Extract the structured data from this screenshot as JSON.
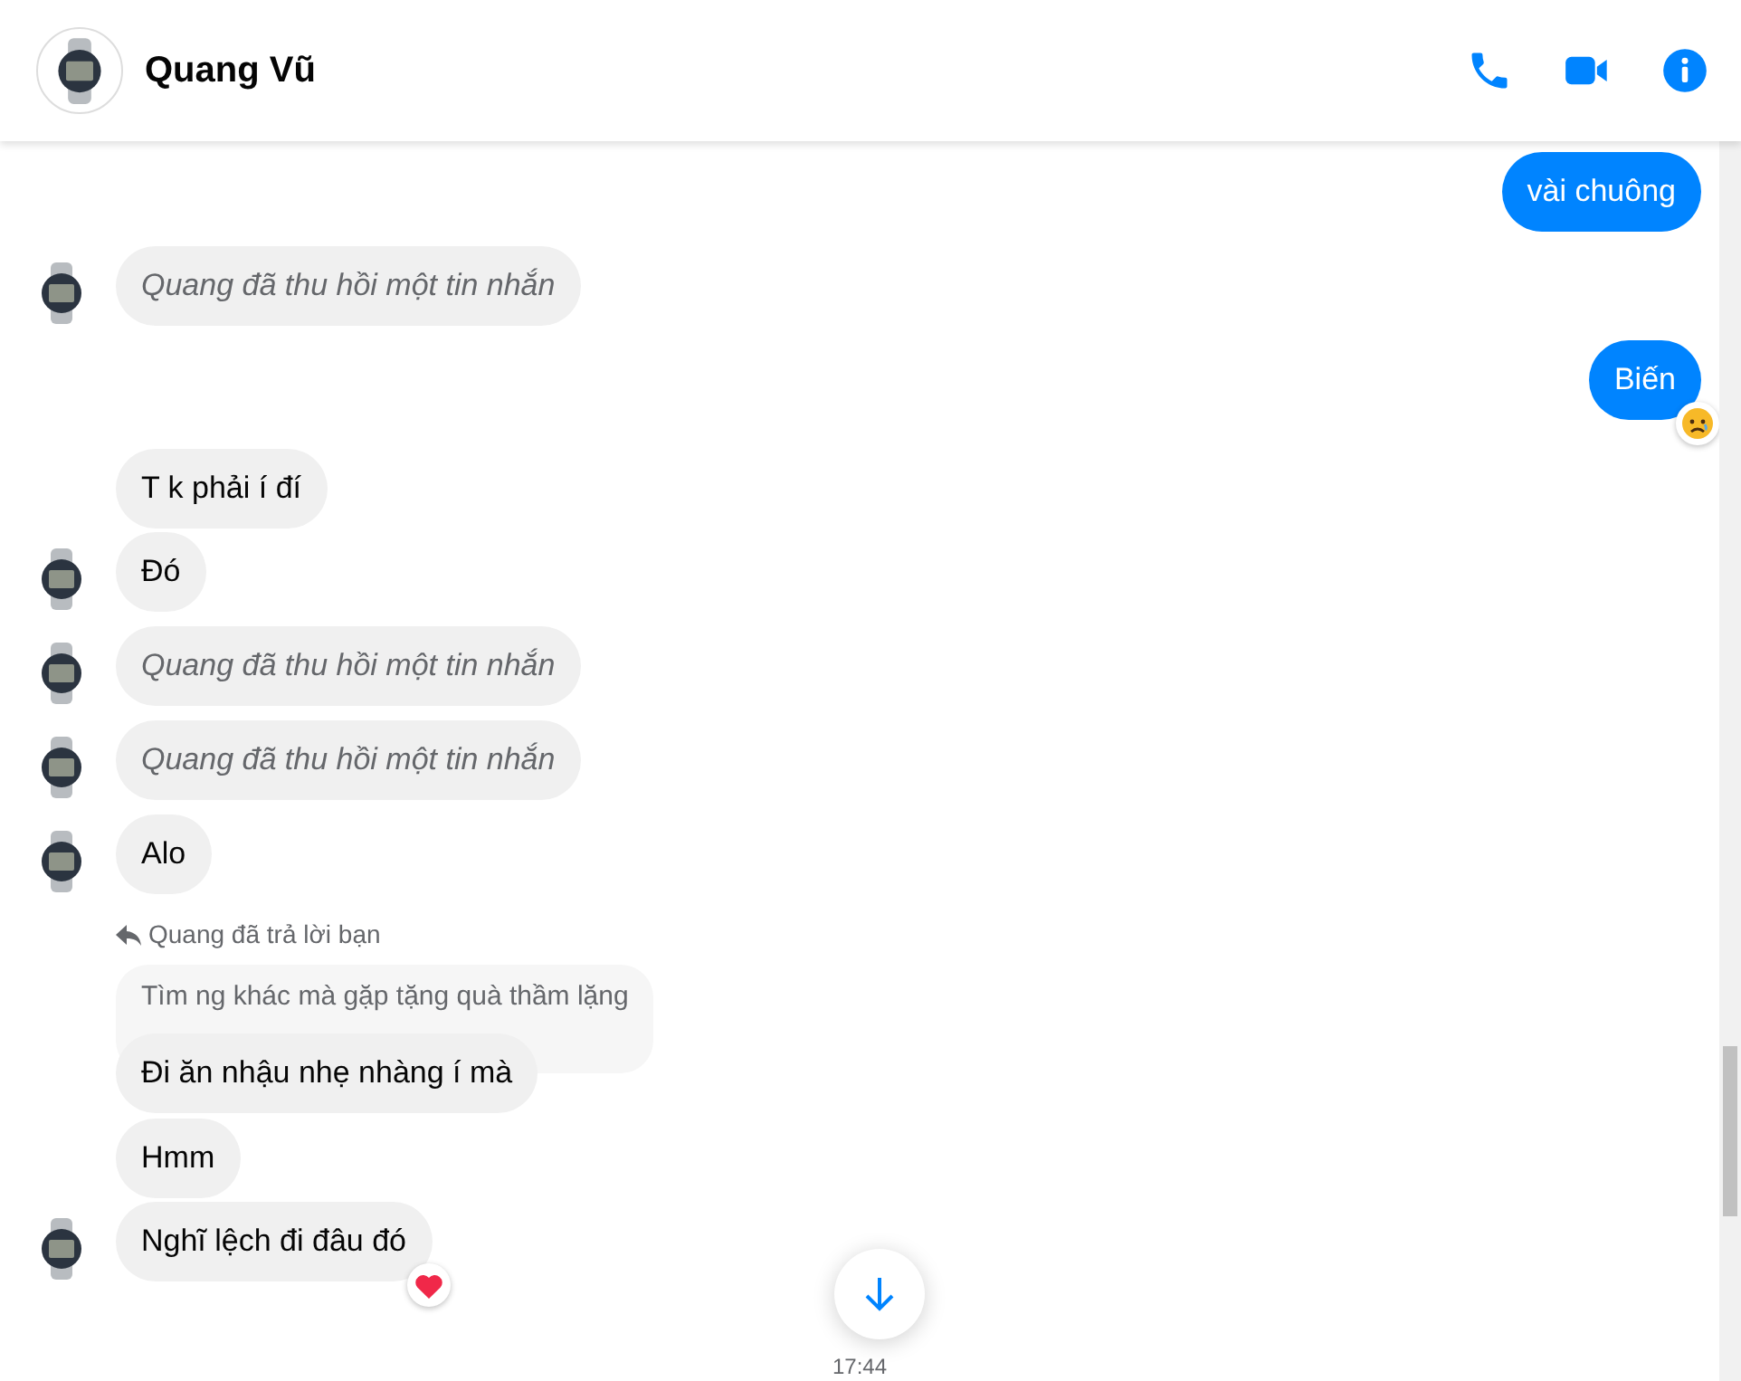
{
  "header": {
    "name": "Quang Vũ"
  },
  "messages": [
    {
      "outgoing": true,
      "kind": "text",
      "text": "vài chuông"
    },
    {
      "outgoing": false,
      "kind": "unsent",
      "text": "Quang đã thu hồi một tin nhắn",
      "avatar": true
    },
    {
      "outgoing": true,
      "kind": "text",
      "text": "Biến",
      "reaction": {
        "kind": "sad"
      }
    },
    {
      "outgoing": false,
      "kind": "text",
      "text": "T k phải í đí",
      "avatar": false
    },
    {
      "outgoing": false,
      "kind": "text",
      "text": "Đó",
      "avatar": true
    },
    {
      "outgoing": false,
      "kind": "unsent",
      "text": "Quang đã thu hồi một tin nhắn",
      "avatar": true
    },
    {
      "outgoing": false,
      "kind": "unsent",
      "text": "Quang đã thu hồi một tin nhắn",
      "avatar": true
    },
    {
      "outgoing": false,
      "kind": "text",
      "text": "Alo",
      "avatar": true
    },
    {
      "outgoing": false,
      "kind": "reply",
      "label": "Quang đã trả lời bạn",
      "quote": "Tìm ng khác mà gặp tặng quà thầm lặng",
      "text": "Đi ăn nhậu nhẹ nhàng í mà",
      "avatar": false
    },
    {
      "outgoing": false,
      "kind": "text",
      "text": "Hmm",
      "avatar": false
    },
    {
      "outgoing": false,
      "kind": "text",
      "text": "Nghĩ lệch đi đâu đó",
      "avatar": true,
      "reaction": {
        "kind": "heart"
      }
    }
  ],
  "timestamp": "17:44"
}
